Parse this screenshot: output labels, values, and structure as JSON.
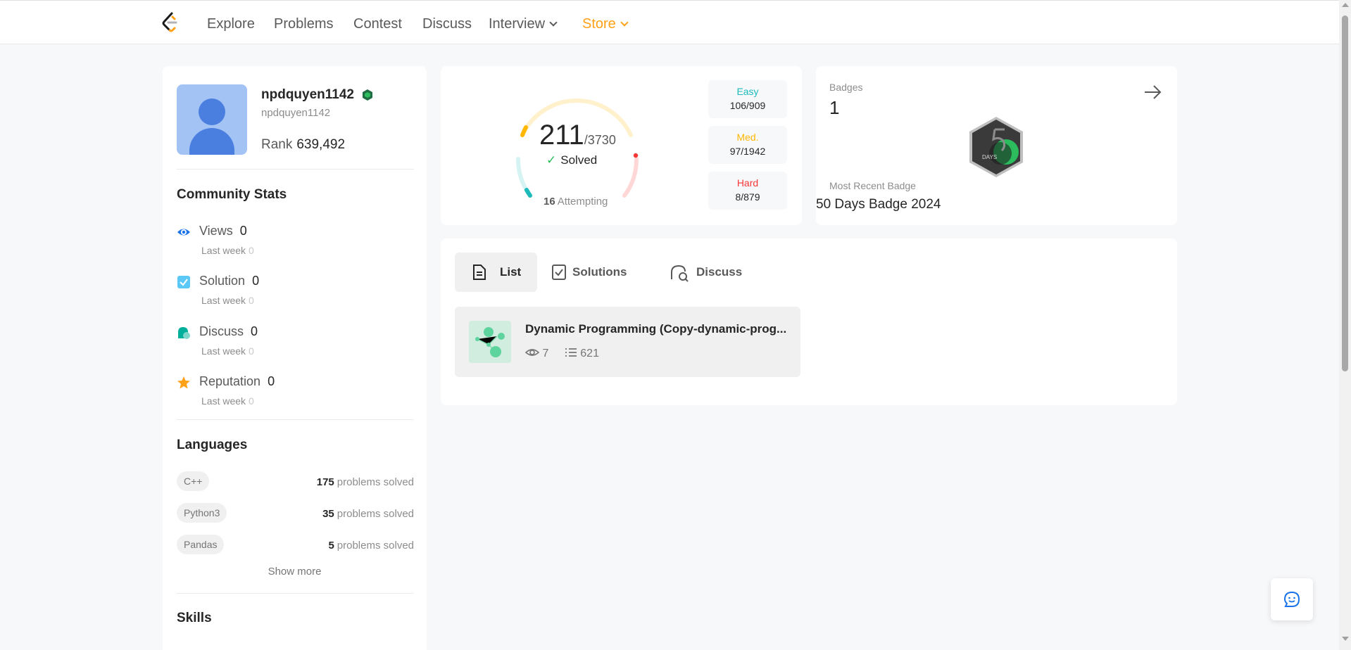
{
  "nav": {
    "items": [
      {
        "label": "Explore"
      },
      {
        "label": "Problems"
      },
      {
        "label": "Contest"
      },
      {
        "label": "Discuss"
      },
      {
        "label": "Interview"
      },
      {
        "label": "Store"
      }
    ],
    "accent_color": "#ffa116"
  },
  "profile": {
    "username": "npdquyen1142",
    "handle": "npdquyen1142",
    "rank_label": "Rank",
    "rank_value": "639,492"
  },
  "community": {
    "title": "Community Stats",
    "stats": [
      {
        "label": "Views",
        "value": "0",
        "last_week_label": "Last week",
        "last_week_value": "0",
        "icon": "eye-icon"
      },
      {
        "label": "Solution",
        "value": "0",
        "last_week_label": "Last week",
        "last_week_value": "0",
        "icon": "solution-check-icon"
      },
      {
        "label": "Discuss",
        "value": "0",
        "last_week_label": "Last week",
        "last_week_value": "0",
        "icon": "discuss-icon"
      },
      {
        "label": "Reputation",
        "value": "0",
        "last_week_label": "Last week",
        "last_week_value": "0",
        "icon": "star-icon"
      }
    ]
  },
  "languages": {
    "title": "Languages",
    "items": [
      {
        "name": "C++",
        "count": "175",
        "suffix": "problems solved"
      },
      {
        "name": "Python3",
        "count": "35",
        "suffix": "problems solved"
      },
      {
        "name": "Pandas",
        "count": "5",
        "suffix": "problems solved"
      }
    ],
    "show_more": "Show more"
  },
  "skills": {
    "title": "Skills"
  },
  "solved": {
    "count": "211",
    "total": "/3730",
    "label": "Solved",
    "attempting_count": "16",
    "attempting_label": "Attempting",
    "difficulties": [
      {
        "label": "Easy",
        "value": "106/909",
        "color": "#1cbaba"
      },
      {
        "label": "Med.",
        "value": "97/1942",
        "color": "#ffb700"
      },
      {
        "label": "Hard",
        "value": "8/879",
        "color": "#f63737"
      }
    ]
  },
  "badges": {
    "label": "Badges",
    "count": "1",
    "recent_label": "Most Recent Badge",
    "recent_name": "50 Days Badge 2024",
    "badge_text": "DAYS"
  },
  "tabs": [
    {
      "label": "List",
      "icon": "document-icon"
    },
    {
      "label": "Solutions",
      "icon": "checkbox-icon"
    },
    {
      "label": "Discuss",
      "icon": "discuss-search-icon"
    }
  ],
  "list_item": {
    "title": "Dynamic Programming (Copy-dynamic-prog...",
    "views": "7",
    "problems": "621"
  }
}
